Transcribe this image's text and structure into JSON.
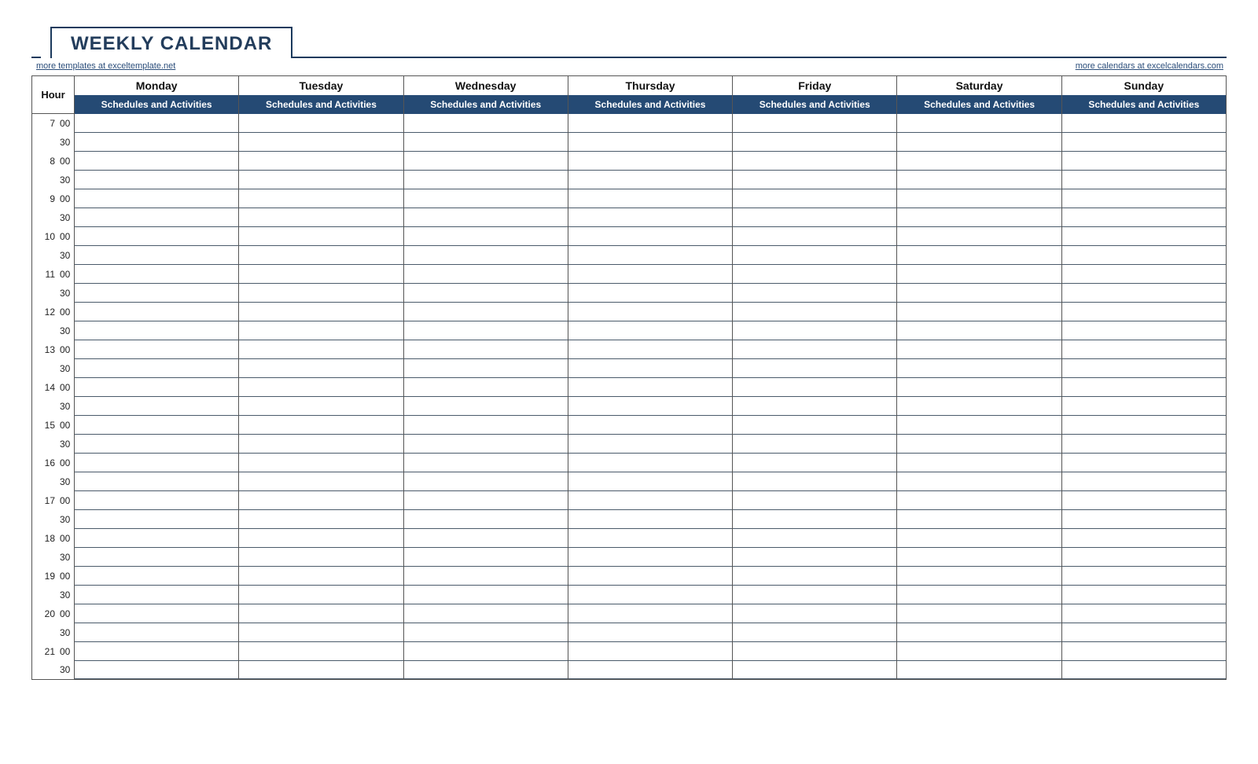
{
  "title": "WEEKLY CALENDAR",
  "links": {
    "left": "more templates at exceltemplate.net",
    "right": "more calendars at excelcalendars.com"
  },
  "header": {
    "hour_label": "Hour",
    "sub_label": "Schedules and Activities",
    "days": [
      "Monday",
      "Tuesday",
      "Wednesday",
      "Thursday",
      "Friday",
      "Saturday",
      "Sunday"
    ]
  },
  "time_slots": [
    {
      "hour": "7",
      "minute": "00"
    },
    {
      "hour": "",
      "minute": "30"
    },
    {
      "hour": "8",
      "minute": "00"
    },
    {
      "hour": "",
      "minute": "30"
    },
    {
      "hour": "9",
      "minute": "00"
    },
    {
      "hour": "",
      "minute": "30"
    },
    {
      "hour": "10",
      "minute": "00"
    },
    {
      "hour": "",
      "minute": "30"
    },
    {
      "hour": "11",
      "minute": "00"
    },
    {
      "hour": "",
      "minute": "30"
    },
    {
      "hour": "12",
      "minute": "00"
    },
    {
      "hour": "",
      "minute": "30"
    },
    {
      "hour": "13",
      "minute": "00"
    },
    {
      "hour": "",
      "minute": "30"
    },
    {
      "hour": "14",
      "minute": "00"
    },
    {
      "hour": "",
      "minute": "30"
    },
    {
      "hour": "15",
      "minute": "00"
    },
    {
      "hour": "",
      "minute": "30"
    },
    {
      "hour": "16",
      "minute": "00"
    },
    {
      "hour": "",
      "minute": "30"
    },
    {
      "hour": "17",
      "minute": "00"
    },
    {
      "hour": "",
      "minute": "30"
    },
    {
      "hour": "18",
      "minute": "00"
    },
    {
      "hour": "",
      "minute": "30"
    },
    {
      "hour": "19",
      "minute": "00"
    },
    {
      "hour": "",
      "minute": "30"
    },
    {
      "hour": "20",
      "minute": "00"
    },
    {
      "hour": "",
      "minute": "30"
    },
    {
      "hour": "21",
      "minute": "00"
    },
    {
      "hour": "",
      "minute": "30"
    }
  ]
}
